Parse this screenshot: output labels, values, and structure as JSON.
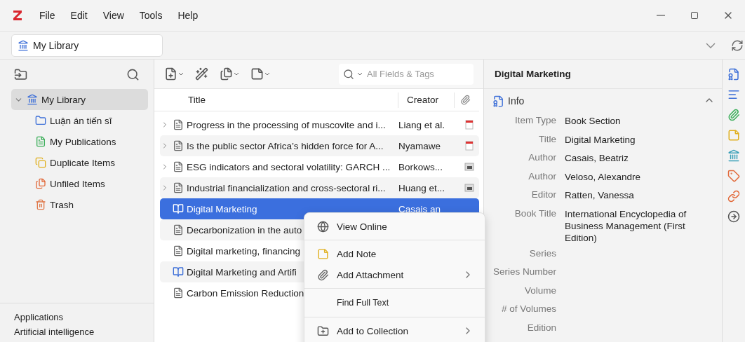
{
  "menubar": [
    "File",
    "Edit",
    "View",
    "Tools",
    "Help"
  ],
  "library_selector": "My Library",
  "collections": [
    {
      "label": "My Library",
      "kind": "library",
      "selected": true,
      "expanded": true,
      "children": [
        {
          "label": "Luận án tiến sĩ",
          "kind": "folder",
          "selected": false
        },
        {
          "label": "My Publications",
          "kind": "publications",
          "selected": false
        },
        {
          "label": "Duplicate Items",
          "kind": "duplicates",
          "selected": false
        },
        {
          "label": "Unfiled Items",
          "kind": "unfiled",
          "selected": false
        },
        {
          "label": "Trash",
          "kind": "trash",
          "selected": false
        }
      ]
    }
  ],
  "tags": [
    "Applications",
    "Artificial intelligence"
  ],
  "search": {
    "placeholder": "All Fields & Tags"
  },
  "columns": [
    "Title",
    "Creator"
  ],
  "rows": [
    {
      "title": "Progress in the processing of muscovite and i...",
      "creator": "Liang et al.",
      "kind": "document",
      "expandable": true,
      "attachment": {
        "kind": "pdf"
      },
      "selected": false
    },
    {
      "title": "Is the public sector Africa’s hidden force for A...",
      "creator": "Nyamawe",
      "kind": "document",
      "expandable": true,
      "attachment": {
        "kind": "pdf"
      },
      "selected": false
    },
    {
      "title": "ESG indicators and sectoral volatility: GARCH ...",
      "creator": "Borkows...",
      "kind": "document",
      "expandable": true,
      "attachment": {
        "kind": "snapshot"
      },
      "selected": false
    },
    {
      "title": "Industrial financialization and cross-sectoral ri...",
      "creator": "Huang et...",
      "kind": "document",
      "expandable": true,
      "attachment": {
        "kind": "snapshot"
      },
      "selected": false
    },
    {
      "title": "Digital Marketing",
      "creator": "Casais an",
      "kind": "book",
      "expandable": false,
      "selected": true
    },
    {
      "title": "Decarbonization in the auto",
      "kind": "document",
      "expandable": false,
      "selected": false
    },
    {
      "title": "Digital marketing, financing",
      "kind": "document",
      "expandable": false,
      "selected": false
    },
    {
      "title": "Digital Marketing and Artifi",
      "kind": "book",
      "expandable": false,
      "selected": false
    },
    {
      "title": "Carbon Emission Reduction",
      "kind": "document",
      "expandable": false,
      "selected": false
    }
  ],
  "context_menu": [
    {
      "kind": "online",
      "label": "View Online",
      "submenu": false
    },
    {
      "kind": "separator"
    },
    {
      "kind": "note",
      "label": "Add Note",
      "submenu": false
    },
    {
      "kind": "attachment",
      "label": "Add Attachment",
      "submenu": true
    },
    {
      "kind": "separator"
    },
    {
      "kind": "fulltext",
      "label": "Find Full Text",
      "submenu": false
    },
    {
      "kind": "separator"
    },
    {
      "kind": "collection",
      "label": "Add to Collection",
      "submenu": true
    }
  ],
  "item_pane": {
    "header": "Digital Marketing",
    "section": "Info",
    "expanded": true,
    "fields": [
      {
        "label": "Item Type",
        "value": "Book Section"
      },
      {
        "label": "Title",
        "value": "Digital Marketing"
      },
      {
        "label": "Author",
        "value": "Casais, Beatriz"
      },
      {
        "label": "Author",
        "value": "Veloso, Alexandre"
      },
      {
        "label": "Editor",
        "value": "Ratten, Vanessa"
      },
      {
        "label": "Book Title",
        "value": "International Encyclopedia of Business Management (First Edition)"
      },
      {
        "label": "Series"
      },
      {
        "label": "Series Number"
      },
      {
        "label": "Volume"
      },
      {
        "label": "# of Volumes"
      },
      {
        "label": "Edition"
      }
    ]
  }
}
